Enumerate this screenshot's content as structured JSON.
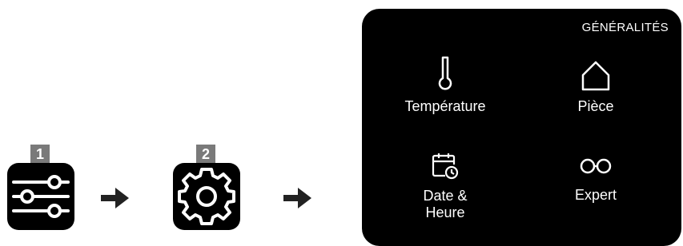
{
  "steps": [
    {
      "number": "1",
      "icon": "sliders-icon"
    },
    {
      "number": "2",
      "icon": "gear-icon"
    }
  ],
  "screen": {
    "title": "GÉNÉRALITÉS",
    "items": [
      {
        "label": "Température",
        "icon": "thermometer-icon"
      },
      {
        "label": "Pièce",
        "icon": "house-icon"
      },
      {
        "label_line1": "Date &",
        "label_line2": "Heure",
        "icon": "calendar-clock-icon"
      },
      {
        "label": "Expert",
        "icon": "glasses-icon"
      }
    ]
  },
  "colors": {
    "screen_bg": "#000000",
    "badge_bg": "#7a7a7a",
    "icon_fg": "#ffffff"
  }
}
